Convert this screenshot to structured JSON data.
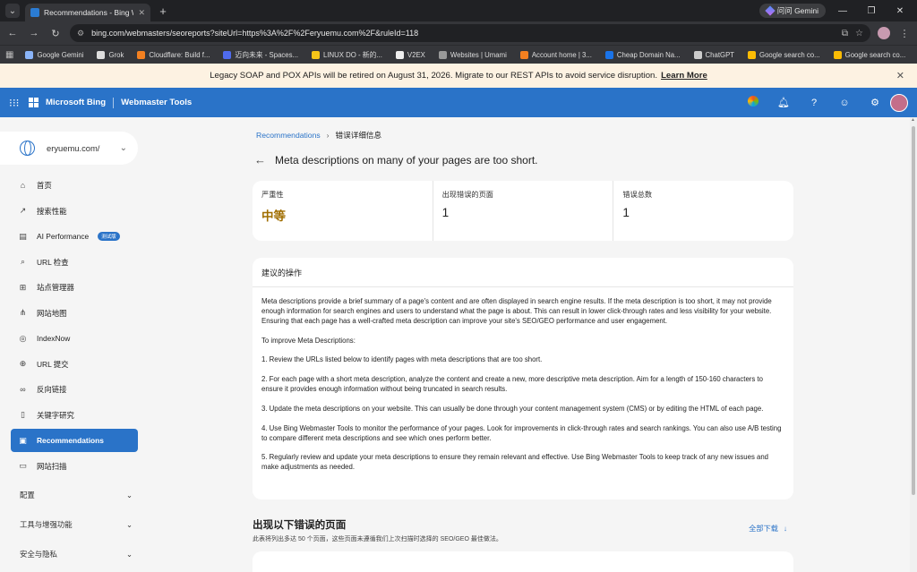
{
  "browser": {
    "tab_title": "Recommendations - Bing We",
    "gemini_label": "问问 Gemini",
    "url": "bing.com/webmasters/seoreports?siteUrl=https%3A%2F%2Feryuemu.com%2F&ruleId=118",
    "bookmarks": [
      {
        "label": "Google Gemini",
        "color": "#8ab4f8"
      },
      {
        "label": "Grok",
        "color": "#dddddd"
      },
      {
        "label": "Cloudflare: Build f...",
        "color": "#f38020"
      },
      {
        "label": "迈向未来 - Spaces...",
        "color": "#4f6bed"
      },
      {
        "label": "LINUX DO - 新的...",
        "color": "#f5c518"
      },
      {
        "label": "V2EX",
        "color": "#eeeeee"
      },
      {
        "label": "Websites | Umami",
        "color": "#999999"
      },
      {
        "label": "Account home | 3...",
        "color": "#f38020"
      },
      {
        "label": "Cheap Domain Na...",
        "color": "#1a73e8"
      },
      {
        "label": "ChatGPT",
        "color": "#cccccc"
      },
      {
        "label": "Google search co...",
        "color": "#fbbc04"
      },
      {
        "label": "Google search co...",
        "color": "#fbbc04"
      }
    ]
  },
  "banner": {
    "text": "Legacy SOAP and POX APIs will be retired on August 31, 2026. Migrate to our REST APIs to avoid service disruption.",
    "link": "Learn More"
  },
  "header": {
    "brand": "Microsoft Bing",
    "product": "Webmaster Tools"
  },
  "sidebar": {
    "site": "eryuemu.com/",
    "items": [
      {
        "label": "首页",
        "icon": "home-icon"
      },
      {
        "label": "搜索性能",
        "icon": "trend-icon"
      },
      {
        "label": "AI Performance",
        "icon": "chart-icon",
        "badge": "测试版"
      },
      {
        "label": "URL 检查",
        "icon": "search-icon"
      },
      {
        "label": "站点管理器",
        "icon": "sitemap-icon"
      },
      {
        "label": "网站地图",
        "icon": "tree-icon"
      },
      {
        "label": "IndexNow",
        "icon": "indexnow-icon"
      },
      {
        "label": "URL 提交",
        "icon": "globe-icon"
      },
      {
        "label": "反向链接",
        "icon": "link-icon"
      },
      {
        "label": "关键字研究",
        "icon": "doc-icon"
      },
      {
        "label": "Recommendations",
        "icon": "recommend-icon",
        "active": true
      },
      {
        "label": "网站扫描",
        "icon": "scan-icon"
      }
    ],
    "groups": [
      "配置",
      "工具与增强功能",
      "安全与隐私"
    ]
  },
  "main": {
    "breadcrumb": {
      "parent": "Recommendations",
      "current": "错误详细信息"
    },
    "title": "Meta descriptions on many of your pages are too short.",
    "stats": [
      {
        "label": "严重性",
        "value": "中等"
      },
      {
        "label": "出现错误的页面",
        "value": "1"
      },
      {
        "label": "错误总数",
        "value": "1"
      }
    ],
    "action": {
      "heading": "建议的操作",
      "paragraphs": [
        "Meta descriptions provide a brief summary of a page's content and are often displayed in search engine results. If the meta description is too short, it may not provide enough information for search engines and users to understand what the page is about. This can result in lower click-through rates and less visibility for your website. Ensuring that each page has a well-crafted meta description can improve your site's SEO/GEO performance and user engagement.",
        "To improve Meta Descriptions:",
        "1. Review the URLs listed below to identify pages with meta descriptions that are too short.",
        "2. For each page with a short meta description, analyze the content and create a new, more descriptive meta description. Aim for a length of 150-160 characters to ensure it provides enough information without being truncated in search results.",
        "3. Update the meta descriptions on your website. This can usually be done through your content management system (CMS) or by editing the HTML of each page.",
        "4. Use Bing Webmaster Tools to monitor the performance of your pages. Look for improvements in click-through rates and search rankings. You can also use A/B testing to compare different meta descriptions and see which ones perform better.",
        "5. Regularly review and update your meta descriptions to ensure they remain relevant and effective. Use Bing Webmaster Tools to keep track of any new issues and make adjustments as needed."
      ]
    },
    "pages_section": {
      "title": "出现以下错误的页面",
      "subtitle": "此表将列出多达 50 个页面，这些页面未遵循我们上次扫描时选择的 SEO/GEO 最佳做法。",
      "download": "全部下载"
    }
  }
}
